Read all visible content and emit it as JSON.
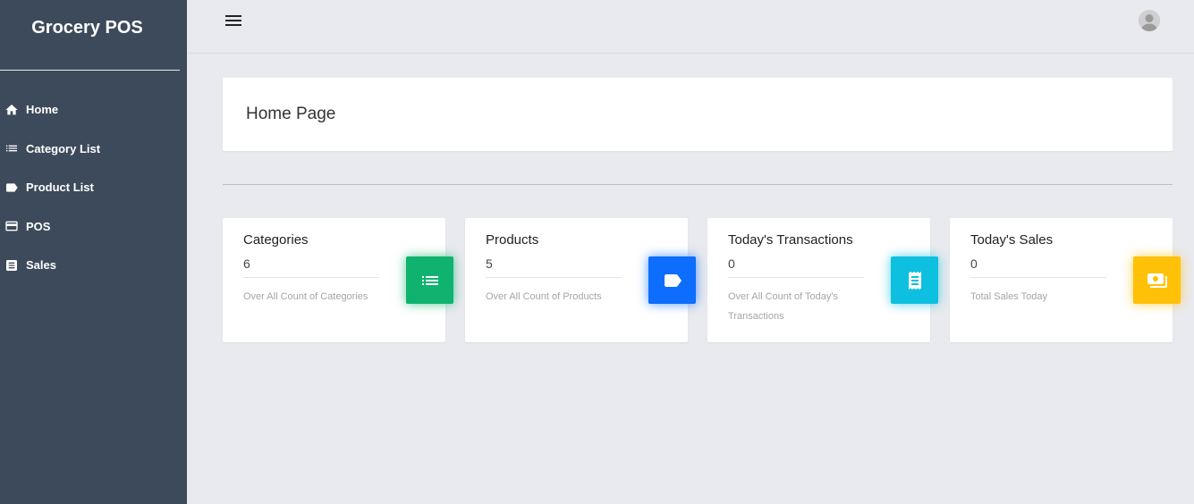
{
  "app": {
    "brand": "Grocery POS"
  },
  "sidebar": {
    "items": [
      {
        "label": "Home",
        "icon": "home-icon"
      },
      {
        "label": "Category List",
        "icon": "list-icon"
      },
      {
        "label": "Product List",
        "icon": "tag-icon"
      },
      {
        "label": "POS",
        "icon": "credit-card-icon"
      },
      {
        "label": "Sales",
        "icon": "receipt-icon"
      }
    ]
  },
  "topbar": {
    "menu_icon": "hamburger-menu-icon",
    "avatar_icon": "user-avatar-icon"
  },
  "page": {
    "title": "Home Page"
  },
  "cards": [
    {
      "title": "Categories",
      "value": "6",
      "desc": "Over All Count of Categories",
      "icon": "list-icon",
      "color": "#0fb36f"
    },
    {
      "title": "Products",
      "value": "5",
      "desc": "Over All Count of Products",
      "icon": "tag-icon",
      "color": "#0d6efd"
    },
    {
      "title": "Today's Transactions",
      "value": "0",
      "desc": "Over All Count of Today's Transactions",
      "icon": "receipt-icon",
      "color": "#0dc0e0"
    },
    {
      "title": "Today's Sales",
      "value": "0",
      "desc": "Total Sales Today",
      "icon": "money-icon",
      "color": "#ffc107"
    }
  ],
  "colors": {
    "sidebar": "#3d4a5b",
    "background": "#e9eaef"
  }
}
